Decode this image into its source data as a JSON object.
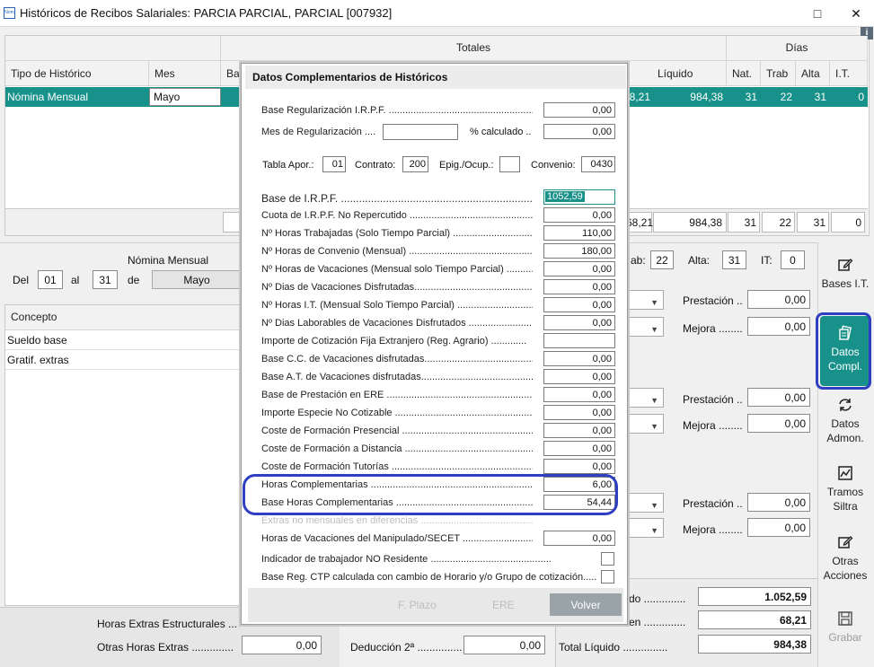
{
  "window": {
    "app_icon_text": "Nom",
    "title": "Históricos de Recibos Salariales: PARCIA PARCIAL, PARCIAL [007932]",
    "minimize": "—",
    "maximize": "□",
    "close": "✕"
  },
  "grid": {
    "group_totales": "Totales",
    "group_dias": "Días",
    "col_tipo": "Tipo de Histórico",
    "col_mes": "Mes",
    "col_base_partial": "Ba",
    "col_liquido": "Líquido",
    "col_nat": "Nat.",
    "col_trab": "Trab",
    "col_alta": "Alta",
    "col_it": "I.T.",
    "row": {
      "tipo": "Nómina Mensual",
      "mes": "Mayo",
      "partial": "68,21",
      "liquido": "984,38",
      "nat": "31",
      "trab": "22",
      "alta": "31",
      "it": "0"
    },
    "totals": {
      "partial": "68,21",
      "liquido": "984,38",
      "nat": "31",
      "trab": "22",
      "alta": "31",
      "it": "0"
    }
  },
  "detail": {
    "title": "Nómina Mensual",
    "del_label": "Del",
    "del_value": "01",
    "al_label": "al",
    "al_value": "31",
    "de_label": "de",
    "month": "Mayo",
    "concepto_header": "Concepto",
    "conceptos": [
      "Sueldo base",
      "Gratif. extras"
    ]
  },
  "right_panel": {
    "trab_label": "ab:",
    "trab_value": "22",
    "alta_label": "Alta:",
    "alta_value": "31",
    "it_label": "IT:",
    "it_value": "0",
    "prestacion_label": "Prestación ..",
    "mejora_label": "Mejora ........",
    "rows": [
      {
        "prestacion": "0,00",
        "mejora": "0,00"
      },
      {
        "prestacion": "0,00",
        "mejora": "0,00"
      },
      {
        "prestacion": "0,00",
        "mejora": "0,00"
      }
    ],
    "total1_label": "do ..............",
    "total1_value": "1.052,59",
    "total2_label": "en ..............",
    "total2_value": "68,21",
    "total_liquido_label": "Total Líquido ...............",
    "total_liquido_value": "984,38"
  },
  "bottom_left": {
    "horas_extras_label": "Horas Extras Estructurales ...",
    "otras_horas_label": "Otras Horas Extras ..............",
    "otras_horas_value": "0,00",
    "deduccion_label": "Deducción 2ª ...............",
    "deduccion_value": "0,00"
  },
  "sidebar": [
    {
      "label": "Bases I.T.",
      "icon": "edit-icon"
    },
    {
      "label": "Datos Compl.",
      "icon": "documents-icon",
      "active": true
    },
    {
      "label": "Datos Admon.",
      "icon": "refresh-icon"
    },
    {
      "label": "Tramos Siltra",
      "icon": "chart-icon"
    },
    {
      "label": "Otras Acciones",
      "icon": "edit-icon"
    },
    {
      "label": "Grabar",
      "icon": "save-icon",
      "disabled": true
    }
  ],
  "modal": {
    "title": "Datos Complementarios de Históricos",
    "base_reg_label": "Base Regularización I.R.P.F. ........................................................",
    "base_reg_value": "0,00",
    "mes_reg_label": "Mes de Regularización ....",
    "mes_reg_value": "",
    "pct_label": "% calculado ..",
    "pct_value": "0,00",
    "tabla_label": "Tabla Apor.:",
    "tabla_value": "01",
    "contrato_label": "Contrato:",
    "contrato_value": "200",
    "epig_label": "Epig./Ocup.:",
    "epig_value": "",
    "convenio_label": "Convenio:",
    "convenio_value": "0430",
    "fields": [
      {
        "label": "Base de I.R.P.F. ..........................................................................",
        "value": "1052,59",
        "selected": true
      },
      {
        "label": "Cuota de I.R.P.F. No Repercutido .........................................................",
        "value": "0,00"
      },
      {
        "label": "Nº Horas Trabajadas (Solo Tiempo Parcial) .............................................",
        "value": "110,00"
      },
      {
        "label": "Nº Horas de Convenio (Mensual) ...........................................................",
        "value": "180,00"
      },
      {
        "label": "Nº Horas de Vacaciones (Mensual solo Tiempo Parcial) ...........",
        "value": "0,00"
      },
      {
        "label": "Nº Dias de Vacaciones Disfrutadas.........................................................",
        "value": "0,00"
      },
      {
        "label": "Nº Horas I.T. (Mensual Solo Tiempo Parcial) .........................................",
        "value": "0,00"
      },
      {
        "label": "Nº Dias Laborables de Vacaciones Disfrutados ......................................",
        "value": "0,00"
      },
      {
        "label": "Importe de Cotización Fija Extranjero (Reg. Agrario) .............",
        "value": ""
      },
      {
        "label": "Base C.C. de Vacaciones disfrutadas..................................................",
        "value": "0,00"
      },
      {
        "label": "Base A.T. de Vacaciones disfrutadas..................................................",
        "value": "0,00"
      },
      {
        "label": "Base de Prestación en ERE ....................................................................",
        "value": "0,00"
      },
      {
        "label": "Importe Especie No Cotizable ................................................................",
        "value": "0,00"
      },
      {
        "label": "Coste de Formación Presencial ...............................................................",
        "value": "0,00"
      },
      {
        "label": "Coste de Formación a Distancia ............................................................",
        "value": "0,00"
      },
      {
        "label": "Coste de Formación Tutorías ...................................................................",
        "value": "0,00"
      },
      {
        "label": "Horas Complementarias .........................................................................",
        "value": "6,00"
      },
      {
        "label": "Base Horas Complementarias ................................................................",
        "value": "54,44"
      },
      {
        "label": "Extras no mensuales en diferencias .........................................................",
        "value": "",
        "disabled": true
      },
      {
        "label": "Horas de Vacaciones del Manipulado/SECET ........................................",
        "value": "0,00"
      }
    ],
    "no_residente_label": "Indicador de trabajador NO Residente ............................................",
    "base_ctp_label": "Base Reg. CTP calculada con cambio de Horario y/o Grupo de cotización.....",
    "btn_fplazo": "F. Plazo",
    "btn_ere": "ERE",
    "btn_volver": "Volver"
  },
  "colors": {
    "accent": "#17918a",
    "highlight_ring": "#2f3fc2"
  }
}
